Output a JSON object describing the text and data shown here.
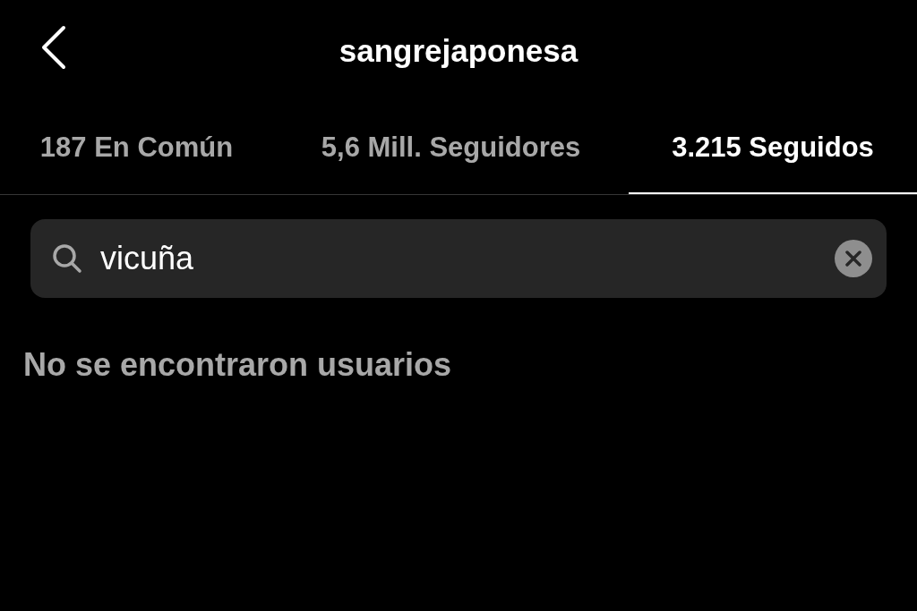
{
  "header": {
    "title": "sangrejaponesa"
  },
  "tabs": [
    {
      "label": "187 En Común",
      "selected": false
    },
    {
      "label": "5,6 Mill. Seguidores",
      "selected": false
    },
    {
      "label": "3.215 Seguidos",
      "selected": true
    }
  ],
  "search": {
    "value": "vicuña"
  },
  "message": "No se encontraron usuarios"
}
